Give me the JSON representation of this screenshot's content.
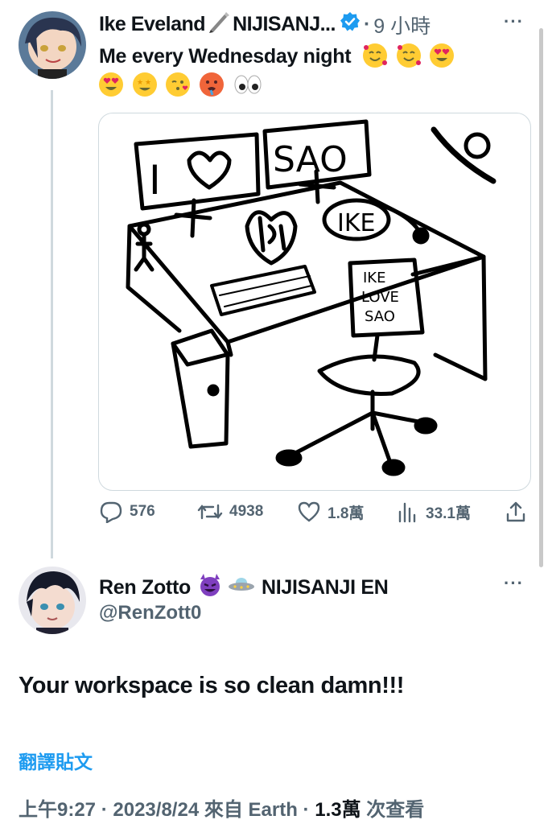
{
  "tweet": {
    "author_name": "Ike Eveland",
    "author_suffix": "NIJISANJ...",
    "separator": "·",
    "time": "9 小時",
    "text": "Me every Wednesday night",
    "emoji_names": [
      "smiling-face-with-hearts",
      "smiling-face-with-hearts",
      "heart-eyes",
      "heart-eyes",
      "star-struck",
      "kissing-heart",
      "hot-face",
      "eyes"
    ],
    "image_text": {
      "monitor_left": "I",
      "monitor_right": "SAO",
      "badge": "IKE",
      "chair_sign_line1": "IKE",
      "chair_sign_line2": "LOVE",
      "chair_sign_line3": "SAO"
    },
    "actions": {
      "replies": "576",
      "reposts": "4938",
      "likes": "1.8萬",
      "views": "33.1萬"
    }
  },
  "reply": {
    "name": "Ren Zotto",
    "name_suffix": "NIJISANJI EN",
    "handle": "@RenZott0",
    "text": "Your workspace is so clean damn!!!",
    "translate_label": "翻譯貼文",
    "time": "上午9:27",
    "date": "2023/8/24",
    "source_prefix": "來自",
    "source": "Earth",
    "views": "1.3萬",
    "views_suffix": "次查看"
  },
  "colors": {
    "text": "#0f1419",
    "muted": "#536471",
    "link": "#1d9bf0",
    "verified": "#1d9bf0",
    "border": "#cfd9de"
  }
}
